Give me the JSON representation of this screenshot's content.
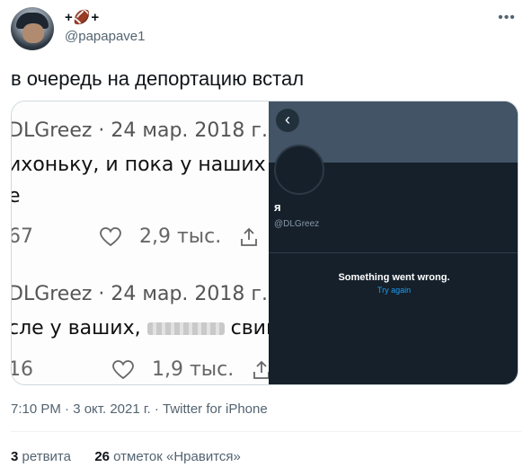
{
  "author": {
    "display_name": "+🏈+",
    "handle": "@papapave1"
  },
  "tweet": {
    "text": "в очередь на депортацию встал",
    "timestamp": "7:10 PM · 3 окт. 2021 г. · Twitter for iPhone",
    "retweets_count": "3",
    "retweets_label": "ретвита",
    "likes_count": "26",
    "likes_label": "отметок «Нравится»"
  },
  "media_left": {
    "post1_meta": "DLGreez · 24 мар. 2018 г.",
    "post1_line1": "ихоньку, и пока у наших с",
    "post1_line2": "е",
    "post1_replies": "67",
    "post1_likes": "2,9 тыс.",
    "post2_meta": "DLGreez · 24 мар. 2018 г.",
    "post2_line1_a": "сле у ваших,",
    "post2_line1_b": "свине",
    "post2_replies": "16",
    "post2_likes": "1,9 тыс."
  },
  "media_right": {
    "profile_name": "я",
    "profile_handle": "@DLGreez",
    "error_message": "Something went wrong.",
    "try_again": "Try again"
  },
  "colors": {
    "dark_bg": "#15202b",
    "banner": "#425465",
    "accent_blue": "#1d9bf0"
  }
}
